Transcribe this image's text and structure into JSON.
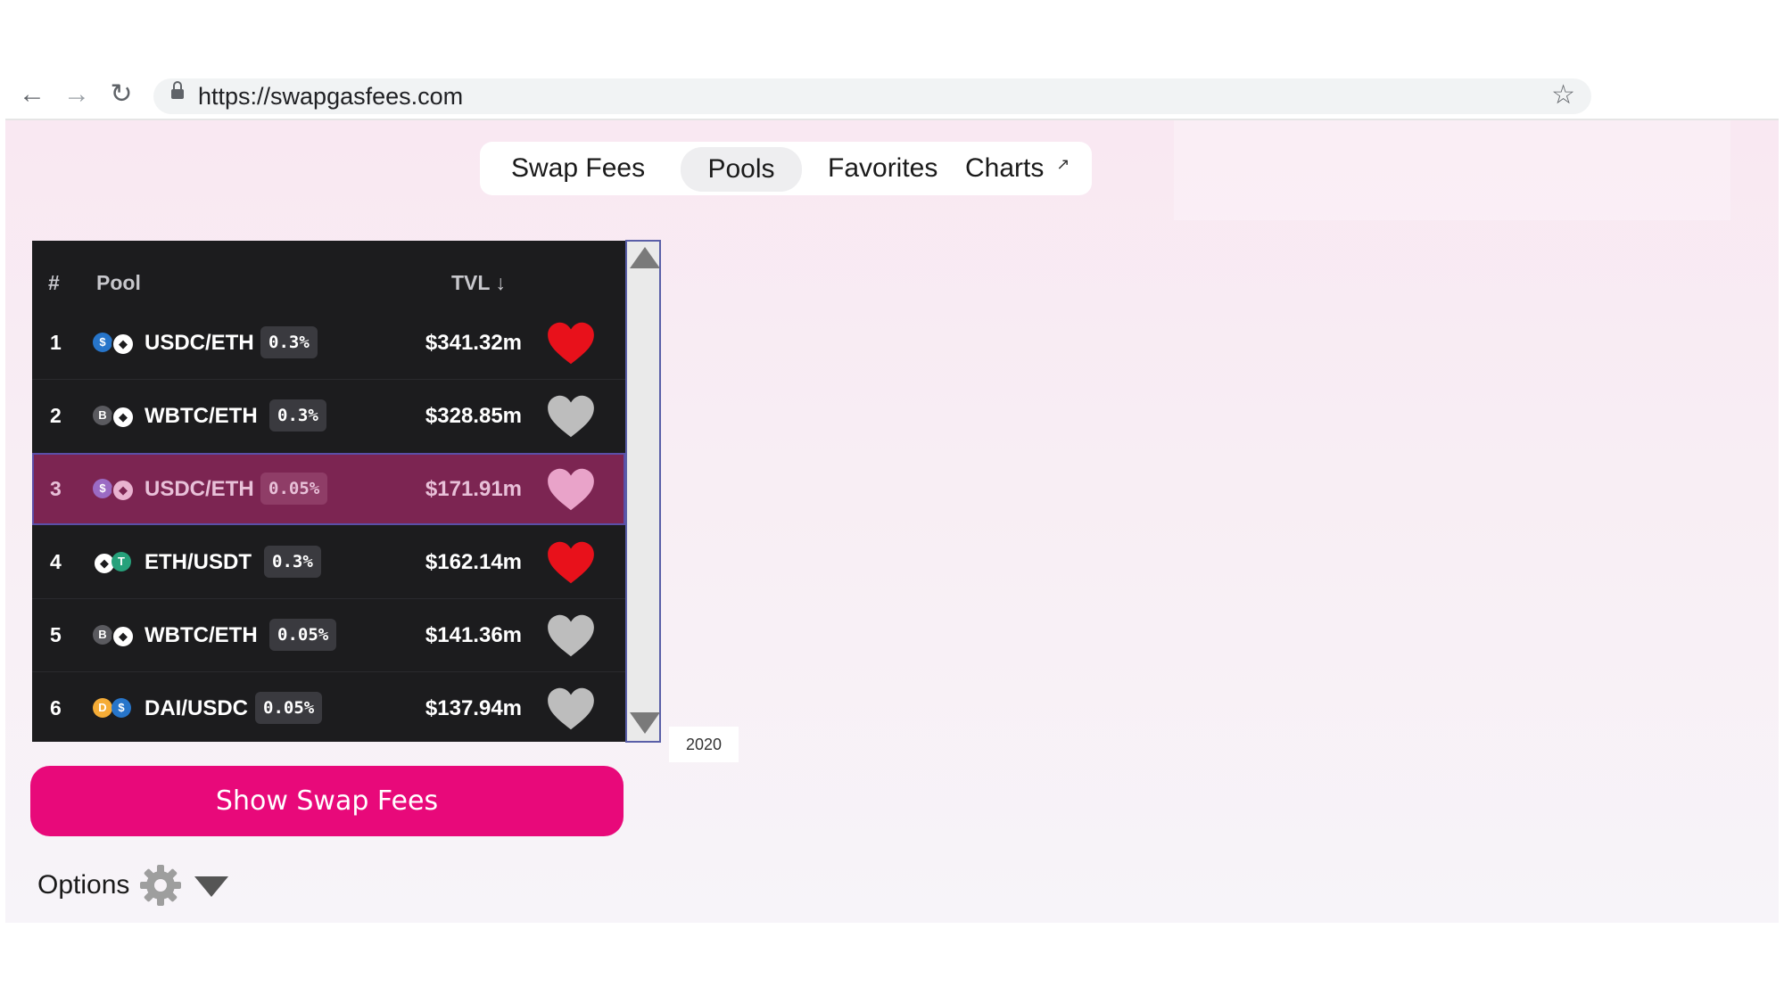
{
  "browser": {
    "back_icon": "arrow-left-icon",
    "forward_icon": "arrow-right-icon",
    "reload_icon": "reload-icon",
    "url": "https://swapgasfees.com",
    "bookmark_icon": "star-icon"
  },
  "tabs": [
    {
      "label": "Swap Fees",
      "active": false
    },
    {
      "label": "Pools",
      "active": true
    },
    {
      "label": "Favorites",
      "active": false
    },
    {
      "label": "Charts",
      "active": false,
      "external_icon": "external-link-icon"
    }
  ],
  "table": {
    "headers": {
      "rank": "#",
      "pool": "Pool",
      "tvl": "TVL ↓"
    },
    "rows": [
      {
        "rank": "1",
        "pair": "USDC/ETH",
        "fee": "0.3%",
        "tvl": "$341.32m",
        "favorite": true,
        "selected": false,
        "tokens": [
          "usdc",
          "eth"
        ]
      },
      {
        "rank": "2",
        "pair": "WBTC/ETH",
        "fee": "0.3%",
        "tvl": "$328.85m",
        "favorite": false,
        "selected": false,
        "tokens": [
          "wbtc",
          "eth"
        ]
      },
      {
        "rank": "3",
        "pair": "USDC/ETH",
        "fee": "0.05%",
        "tvl": "$171.91m",
        "favorite": false,
        "selected": true,
        "tokens": [
          "usdc",
          "eth"
        ]
      },
      {
        "rank": "4",
        "pair": "ETH/USDT",
        "fee": "0.3%",
        "tvl": "$162.14m",
        "favorite": true,
        "selected": false,
        "tokens": [
          "eth",
          "usdt"
        ]
      },
      {
        "rank": "5",
        "pair": "WBTC/ETH",
        "fee": "0.05%",
        "tvl": "$141.36m",
        "favorite": false,
        "selected": false,
        "tokens": [
          "wbtc",
          "eth"
        ]
      },
      {
        "rank": "6",
        "pair": "DAI/USDC",
        "fee": "0.05%",
        "tvl": "$137.94m",
        "favorite": false,
        "selected": false,
        "tokens": [
          "dai",
          "usdc"
        ]
      }
    ]
  },
  "year_tooltip": "2020",
  "show_swap_fees_button": "Show Swap Fees",
  "options": {
    "label": "Options",
    "gear_icon": "gear-icon",
    "dropdown_icon": "caret-down-icon"
  },
  "colors": {
    "accent": "#e8097a",
    "favorite_heart": "#e8111b",
    "unfavorite_heart": "#bdbdbd",
    "selected_heart": "#e9a3c9",
    "table_bg": "#1c1c1e",
    "selected_row": "#7c2552"
  }
}
